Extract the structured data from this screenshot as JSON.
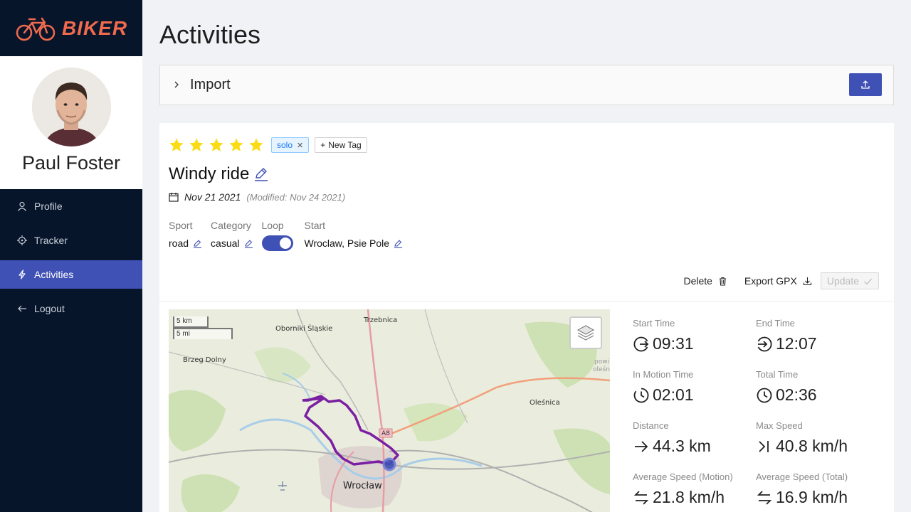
{
  "app": {
    "brand": "BIKER"
  },
  "user": {
    "name": "Paul Foster"
  },
  "sidebar": {
    "items": [
      {
        "label": "Profile",
        "icon": "user-icon"
      },
      {
        "label": "Tracker",
        "icon": "crosshair-icon"
      },
      {
        "label": "Activities",
        "icon": "bolt-icon"
      },
      {
        "label": "Logout",
        "icon": "arrow-left-icon"
      }
    ],
    "active": "Activities"
  },
  "page": {
    "title": "Activities"
  },
  "import": {
    "label": "Import"
  },
  "activity": {
    "rating": 5,
    "rating_max": 5,
    "tags": [
      "solo"
    ],
    "new_tag_label": "New Tag",
    "title": "Windy ride",
    "date": "Nov 21 2021",
    "modified": "(Modified: Nov 24 2021)",
    "fields": {
      "sport_label": "Sport",
      "sport_value": "road",
      "category_label": "Category",
      "category_value": "casual",
      "loop_label": "Loop",
      "loop_value": true,
      "start_label": "Start",
      "start_value": "Wroclaw, Psie Pole"
    },
    "actions": {
      "delete": "Delete",
      "export": "Export GPX",
      "update": "Update"
    }
  },
  "map": {
    "scale_km": "5 km",
    "scale_mi": "5 mi",
    "places": [
      "Oborniki Śląskie",
      "Trzebnica",
      "Brzeg Dolny",
      "Oleśnica",
      "Wrocław",
      "A8",
      "powi",
      "oleśn"
    ]
  },
  "stats": [
    {
      "label": "Start Time",
      "value": "09:31",
      "icon": "clock-start-icon"
    },
    {
      "label": "End Time",
      "value": "12:07",
      "icon": "clock-end-icon"
    },
    {
      "label": "In Motion Time",
      "value": "02:01",
      "icon": "clock-motion-icon"
    },
    {
      "label": "Total Time",
      "value": "02:36",
      "icon": "clock-icon"
    },
    {
      "label": "Distance",
      "value": "44.3 km",
      "icon": "arrow-right-icon"
    },
    {
      "label": "Max Speed",
      "value": "40.8 km/h",
      "icon": "max-speed-icon"
    },
    {
      "label": "Average Speed (Motion)",
      "value": "21.8 km/h",
      "icon": "swap-icon"
    },
    {
      "label": "Average Speed (Total)",
      "value": "16.9 km/h",
      "icon": "swap-icon"
    }
  ],
  "colors": {
    "sidebar": "#07152b",
    "accent": "#3f51b5",
    "brand": "#f06a4d",
    "star": "#fadb14",
    "route": "#7b1fa2"
  }
}
